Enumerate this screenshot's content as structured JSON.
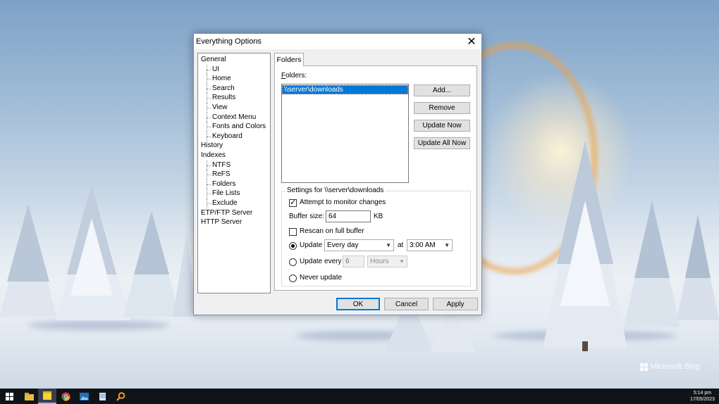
{
  "dialog": {
    "title": "Everything Options",
    "close_glyph": "✕",
    "tree": [
      {
        "label": "General",
        "level": 0
      },
      {
        "label": "UI",
        "level": 1
      },
      {
        "label": "Home",
        "level": 1
      },
      {
        "label": "Search",
        "level": 1
      },
      {
        "label": "Results",
        "level": 1
      },
      {
        "label": "View",
        "level": 1
      },
      {
        "label": "Context Menu",
        "level": 1
      },
      {
        "label": "Fonts and Colors",
        "level": 1
      },
      {
        "label": "Keyboard",
        "level": 1
      },
      {
        "label": "History",
        "level": 0
      },
      {
        "label": "Indexes",
        "level": 0
      },
      {
        "label": "NTFS",
        "level": 1
      },
      {
        "label": "ReFS",
        "level": 1
      },
      {
        "label": "Folders",
        "level": 1
      },
      {
        "label": "File Lists",
        "level": 1
      },
      {
        "label": "Exclude",
        "level": 1
      },
      {
        "label": "ETP/FTP Server",
        "level": 0
      },
      {
        "label": "HTTP Server",
        "level": 0
      }
    ],
    "tab_label": "Folders",
    "folders_label": "Folders:",
    "folders": [
      "\\\\server\\downloads"
    ],
    "buttons": {
      "add": "Add...",
      "remove": "Remove",
      "update_now": "Update Now",
      "update_all_now": "Update All Now"
    },
    "settings": {
      "legend": "Settings for \\\\server\\downloads",
      "monitor_label": "Attempt to monitor changes",
      "monitor_checked": true,
      "buffer_label": "Buffer size:",
      "buffer_value": "64",
      "buffer_unit": "KB",
      "rescan_label": "Rescan on full buffer",
      "rescan_checked": false,
      "update_label": "Update",
      "update_selected": true,
      "update_frequency": "Every day",
      "at_label": "at",
      "update_time": "3:00 AM",
      "update_every_label": "Update every",
      "update_every_value": "6",
      "update_every_unit": "Hours",
      "never_label": "Never update"
    },
    "footer": {
      "ok": "OK",
      "cancel": "Cancel",
      "apply": "Apply"
    }
  },
  "desktop": {
    "watermark": "Microsoft Bing"
  },
  "taskbar": {
    "time": "5:14 pm",
    "date": "17/05/2023"
  }
}
